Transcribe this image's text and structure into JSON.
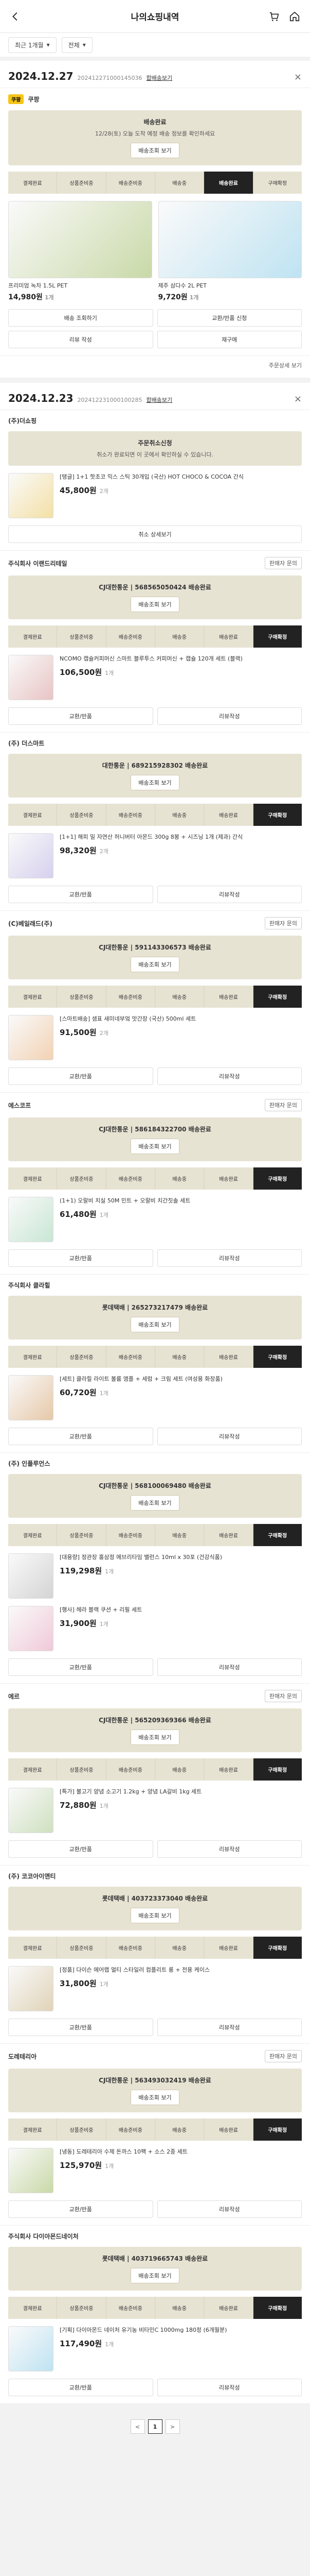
{
  "header": {
    "title": "나의쇼핑내역"
  },
  "filters": [
    {
      "label": "최근 1개월"
    },
    {
      "label": "전체"
    }
  ],
  "steps": [
    "결제완료",
    "상품준비중",
    "배송준비중",
    "배송중",
    "배송완료",
    "구매확정",
    "배송완료"
  ],
  "orders": [
    {
      "date": "2024.12.27",
      "no": "202412271000145036",
      "link": "합배송보기",
      "shops": [
        {
          "name": "쿠팡",
          "logo": "쿠팡",
          "badge": "",
          "delivery": {
            "company": "배송완료",
            "msg": "12/28(토) 오늘 도착 예정 배송 정보를 확인하세요",
            "btn": "배송조회 보기"
          },
          "active_step": 4,
          "layout": "grid",
          "items": [
            {
              "name": "프리미엄 녹차 1.5L PET",
              "price": "14,980원",
              "qty": "1개"
            },
            {
              "name": "제주 삼다수 2L PET",
              "price": "9,720원",
              "qty": "1개"
            }
          ],
          "actions": [
            "배송 조회하기",
            "교환/반품 신청",
            "리뷰 작성",
            "재구매"
          ]
        }
      ],
      "more": "주문상세 보기"
    },
    {
      "date": "2024.12.23",
      "no": "202412231000100285",
      "link": "합배송보기",
      "shops": [
        {
          "name": "(주)더쇼핑",
          "badge": "",
          "delivery": {
            "company": "주문취소신청",
            "msg": "취소가 완료되면 이 곳에서 확인하실 수 있습니다.",
            "btn": ""
          },
          "active_step": -1,
          "items": [
            {
              "name": "[탱글] 1+1 핫초코 믹스 스틱 30개입 (국산) HOT CHOCO & COCOA 간식",
              "price": "45,800원",
              "qty": "2개"
            }
          ],
          "actions": [
            "취소 상세보기"
          ]
        },
        {
          "name": "주식회사 이랜드리테일",
          "badge": "판매자 문의",
          "delivery": {
            "company": "CJ대한통운 | 568565050424 배송완료",
            "msg": "",
            "btn": "배송조회 보기"
          },
          "active_step": 6,
          "items": [
            {
              "name": "NCOMO 캡슐커피머신 스마트 블루투스 커피머신 + 캡슐 120개 세트 (블랙)",
              "price": "106,500원",
              "qty": "1개"
            }
          ],
          "actions": [
            "교환/반품",
            "리뷰작성"
          ]
        },
        {
          "name": "(주) 더스마트",
          "badge": "",
          "delivery": {
            "company": "대한통운 | 689215928302 배송완료",
            "msg": "",
            "btn": "배송조회 보기"
          },
          "active_step": 6,
          "items": [
            {
              "name": "[1+1] 해피 밀 자연산 허니버터 아몬드 300g 8봉 + 시즈닝 1개 (제과) 간식",
              "price": "98,320원",
              "qty": "2개"
            }
          ],
          "actions": [
            "교환/반품",
            "리뷰작성"
          ]
        },
        {
          "name": "(C)베일래드(주)",
          "badge": "판매자 문의",
          "delivery": {
            "company": "CJ대한통운 | 591143306573 배송완료",
            "msg": "",
            "btn": "배송조회 보기"
          },
          "active_step": 6,
          "items": [
            {
              "name": "[스마트배송] 샘표 새미네부엌 맛간장 (국산) 500ml 세트",
              "price": "91,500원",
              "qty": "2개"
            }
          ],
          "actions": [
            "교환/반품",
            "리뷰작성"
          ]
        },
        {
          "name": "에스코프",
          "badge": "판매자 문의",
          "delivery": {
            "company": "CJ대한통운 | 586184322700 배송완료",
            "msg": "",
            "btn": "배송조회 보기"
          },
          "active_step": 6,
          "items": [
            {
              "name": "(1+1) 오랄비 치실 50M 민트 + 오랄비 치간칫솔 세트",
              "price": "61,480원",
              "qty": "1개"
            }
          ],
          "actions": [
            "교환/반품",
            "리뷰작성"
          ]
        },
        {
          "name": "주식회사 클라힐",
          "badge": "",
          "delivery": {
            "company": "롯데택배 | 265273217479 배송완료",
            "msg": "",
            "btn": "배송조회 보기"
          },
          "active_step": 6,
          "items": [
            {
              "name": "[세트] 클라힐 라이트 볼륨 앰플 + 세럼 + 크림 세트 (여성용 화장품)",
              "price": "60,720원",
              "qty": "1개"
            }
          ],
          "actions": [
            "교환/반품",
            "리뷰작성"
          ]
        },
        {
          "name": "(주) 인플루언스",
          "badge": "",
          "delivery": {
            "company": "CJ대한통운 | 568100069480 배송완료",
            "msg": "",
            "btn": "배송조회 보기"
          },
          "active_step": 6,
          "items": [
            {
              "name": "[대용량] 정관장 홍삼정 에브리타임 밸런스 10ml x 30포 (건강식품)",
              "price": "119,298원",
              "qty": "1개"
            },
            {
              "name": "[행사] 헤라 블랙 쿠션 + 리필 세트",
              "price": "31,900원",
              "qty": "1개"
            }
          ],
          "actions": [
            "교환/반품",
            "리뷰작성"
          ]
        },
        {
          "name": "에르",
          "badge": "판매자 문의",
          "delivery": {
            "company": "CJ대한통운 | 565209369366 배송완료",
            "msg": "",
            "btn": "배송조회 보기"
          },
          "active_step": 6,
          "items": [
            {
              "name": "[특가] 불고기 양념 소고기 1.2kg + 양념 LA갈비 1kg 세트",
              "price": "72,880원",
              "qty": "1개"
            }
          ],
          "actions": [
            "교환/반품",
            "리뷰작성"
          ]
        },
        {
          "name": "(주) 코코아이앤티",
          "badge": "",
          "delivery": {
            "company": "롯데택배 | 403723373040 배송완료",
            "msg": "",
            "btn": "배송조회 보기"
          },
          "active_step": 6,
          "items": [
            {
              "name": "[정품] 다이슨 에어랩 멀티 스타일러 컴플리트 롱 + 전용 케이스",
              "price": "31,800원",
              "qty": "1개"
            }
          ],
          "actions": [
            "교환/반품",
            "리뷰작성"
          ]
        },
        {
          "name": "도레테리아",
          "badge": "판매자 문의",
          "delivery": {
            "company": "CJ대한통운 | 563493032419 배송완료",
            "msg": "",
            "btn": "배송조회 보기"
          },
          "active_step": 6,
          "items": [
            {
              "name": "[냉동] 도레테리아 수제 돈까스 10팩 + 소스 2종 세트",
              "price": "125,970원",
              "qty": "1개"
            }
          ],
          "actions": [
            "교환/반품",
            "리뷰작성"
          ]
        },
        {
          "name": "주식회사 다이아몬드네이처",
          "badge": "",
          "delivery": {
            "company": "롯데택배 | 403719665743 배송완료",
            "msg": "",
            "btn": "배송조회 보기"
          },
          "active_step": 6,
          "items": [
            {
              "name": "[기획] 다이아몬드 네이처 유기농 비타민C 1000mg 180정 (6개월분)",
              "price": "117,490원",
              "qty": "1개"
            }
          ],
          "actions": [
            "교환/반품",
            "리뷰작성"
          ]
        }
      ],
      "more": ""
    }
  ],
  "pagination": {
    "prev": "<",
    "current": "1",
    "next": ">"
  }
}
